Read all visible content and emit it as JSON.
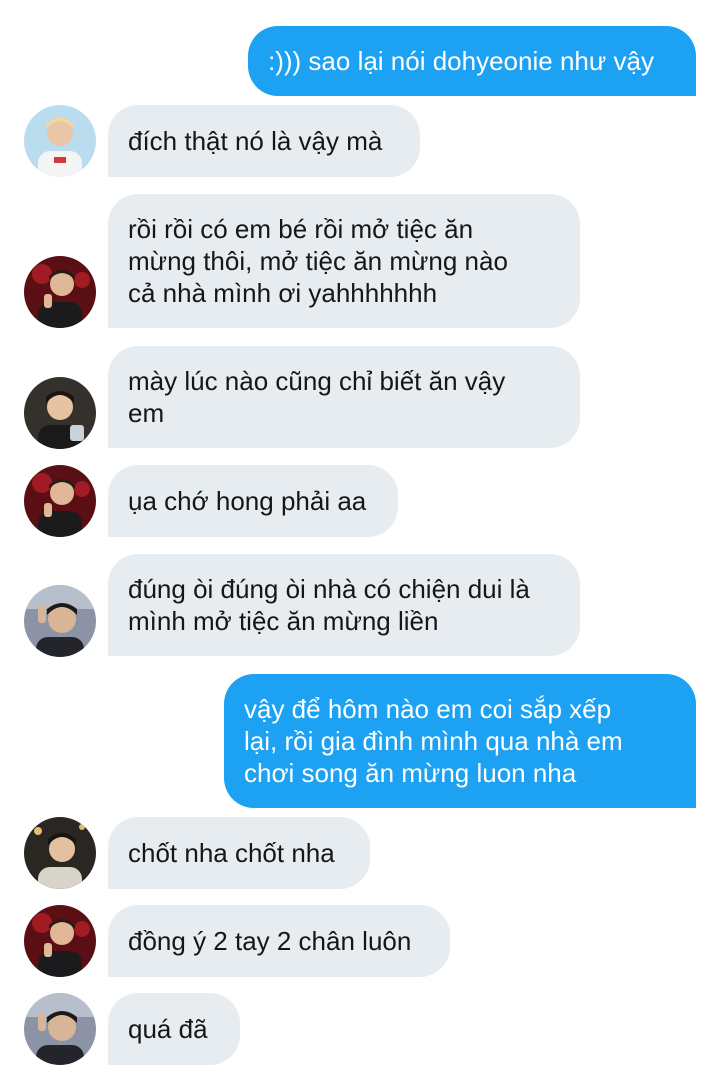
{
  "conversation": {
    "messages": [
      {
        "sender": "self",
        "text": ":))) sao lại nói dohyeonie như vậy"
      },
      {
        "sender": "user-a",
        "text": "đích thật nó là vậy mà"
      },
      {
        "sender": "user-b",
        "text": "rồi rồi có em bé rồi mở tiệc ăn\nmừng thôi, mở tiệc ăn mừng nào\ncả nhà mình ơi yahhhhhhh"
      },
      {
        "sender": "user-c",
        "text": "mày lúc nào cũng chỉ biết ăn vậy\nem"
      },
      {
        "sender": "user-b",
        "text": "ụa chớ hong phải aa"
      },
      {
        "sender": "user-d",
        "text": "đúng òi đúng òi nhà có chiện dui là\nmình mở tiệc ăn mừng liền"
      },
      {
        "sender": "self",
        "text": "vậy để hôm nào em coi sắp xếp\nlại, rồi gia đình mình qua nhà em\nchơi song ăn mừng luon nha"
      },
      {
        "sender": "user-e",
        "text": "chốt nha chốt nha"
      },
      {
        "sender": "user-b",
        "text": "đồng ý 2 tay 2 chân luôn"
      },
      {
        "sender": "user-d",
        "text": "quá đã"
      }
    ]
  },
  "colors": {
    "outgoing_bubble": "#1da1f2",
    "incoming_bubble": "#e6ecf0",
    "outgoing_text": "#ffffff",
    "incoming_text": "#14171a"
  }
}
